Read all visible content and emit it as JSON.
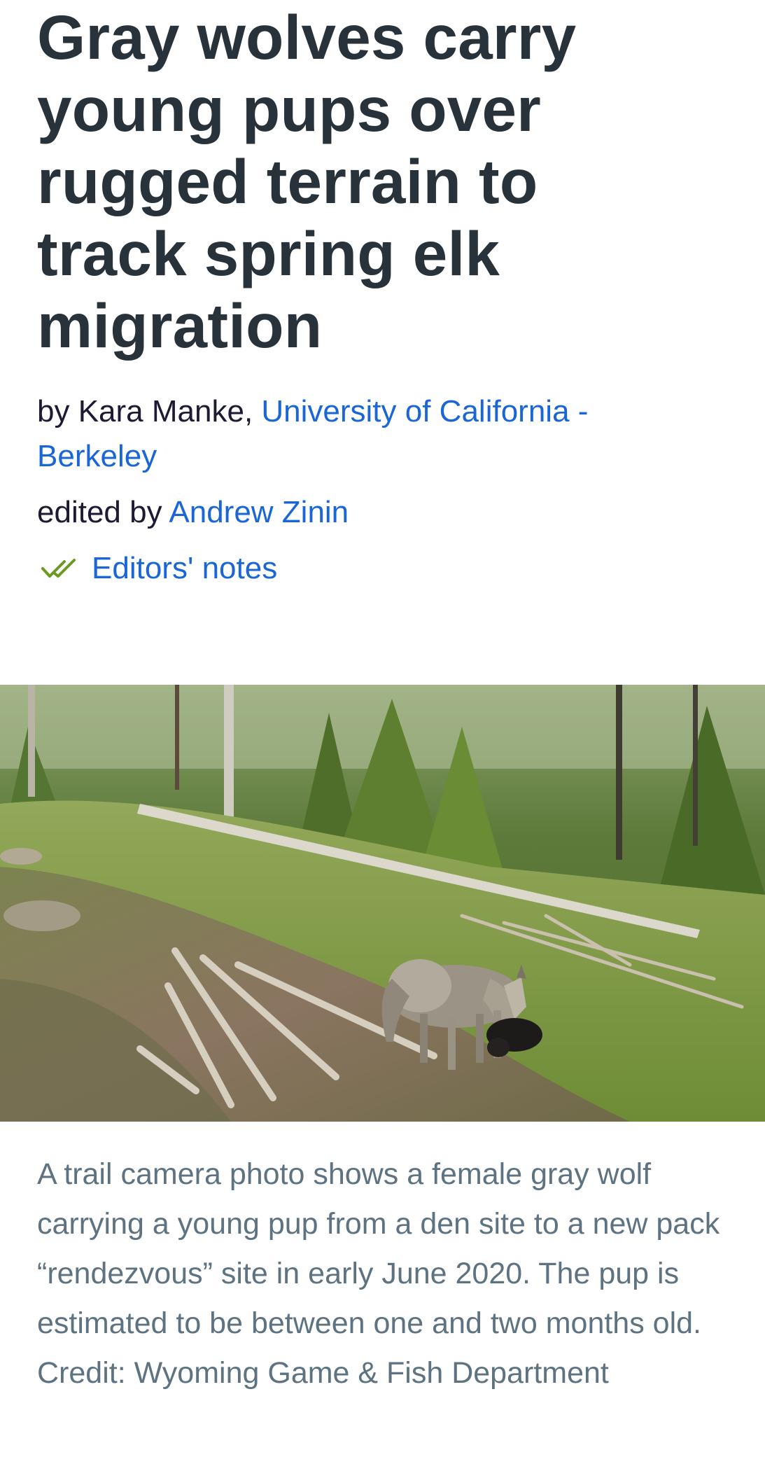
{
  "article": {
    "headline_lines": [
      "Gray wolves carry",
      "young pups over",
      "rugged terrain to",
      "track spring elk",
      "migration"
    ],
    "byline": {
      "prefix": "by ",
      "author": "Kara Manke",
      "separator": ", ",
      "source_line1": "University of California -",
      "source_line2": "Berkeley"
    },
    "edited": {
      "prefix": "edited by ",
      "editor": "Andrew Zinin"
    },
    "editors_notes": {
      "icon": "double-check-icon",
      "label": "Editors' notes"
    },
    "photo": {
      "subject": "trail camera photo of gray wolf carrying pup"
    },
    "caption": "A trail camera photo shows a female gray wolf carrying a young pup from a den site to a new pack “rendezvous” site in early June 2020. The pup is estimated to be between one and two months old. Credit: Wyoming Game & Fish Department"
  },
  "colors": {
    "headline": "#27323a",
    "text": "#1d1a33",
    "link": "#1a66d6",
    "caption": "#5d7381",
    "check_icon": "#6a9a1f"
  }
}
